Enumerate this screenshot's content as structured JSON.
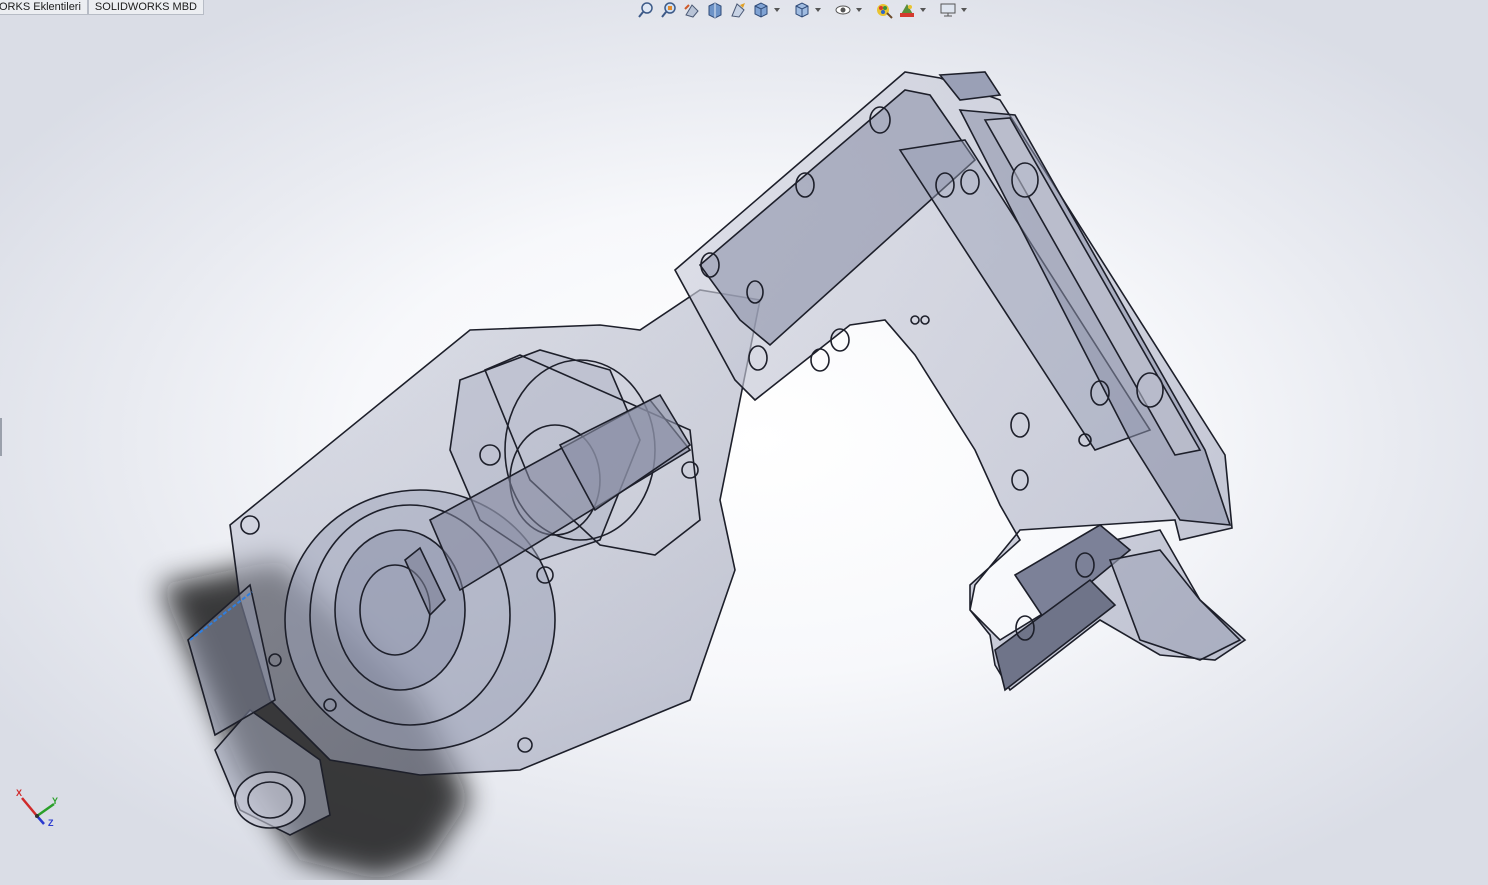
{
  "tabs": [
    {
      "label": "ORKS Eklentileri"
    },
    {
      "label": "SOLIDWORKS MBD"
    }
  ],
  "heads_up_toolbar": [
    {
      "icon": "zoom-to-fit-icon"
    },
    {
      "icon": "zoom-to-area-icon"
    },
    {
      "icon": "previous-view-icon"
    },
    {
      "icon": "section-view-icon"
    },
    {
      "icon": "dynamic-annotation-views-icon"
    },
    {
      "icon": "view-orientation-icon",
      "dropdown": true
    },
    {
      "icon": "display-style-icon",
      "dropdown": true
    },
    {
      "icon": "hide-show-items-icon",
      "dropdown": true
    },
    {
      "icon": "edit-appearance-icon"
    },
    {
      "icon": "apply-scene-icon",
      "dropdown": true
    },
    {
      "icon": "view-settings-icon",
      "dropdown": true
    }
  ],
  "triad": {
    "x_label": "X",
    "y_label": "Y",
    "z_label": "Z"
  },
  "colors": {
    "part_fill": "#b9bdd0",
    "part_edge": "#1d1f2a",
    "shadow": "#111111",
    "selected_edge": "#2f7fe0"
  }
}
